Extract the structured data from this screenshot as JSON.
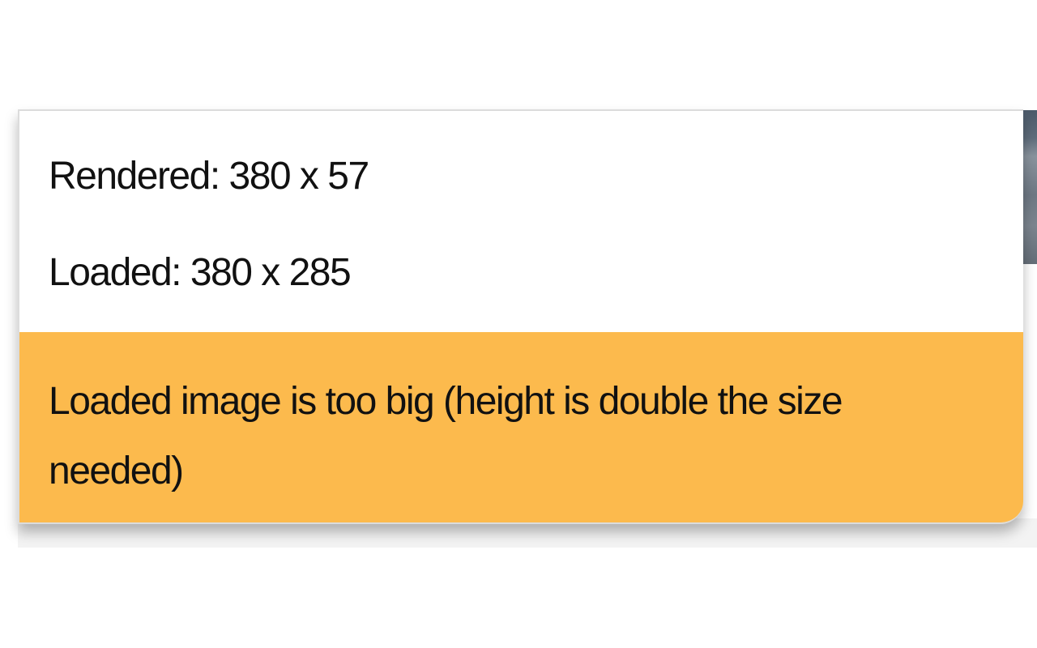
{
  "popover": {
    "rendered_label": "Rendered:",
    "rendered_value": "380 x 57",
    "loaded_label": "Loaded:",
    "loaded_value": "380 x 285",
    "warning_message": "Loaded image is too big (height is double the size needed)",
    "warning_color": "#fcba4d"
  }
}
